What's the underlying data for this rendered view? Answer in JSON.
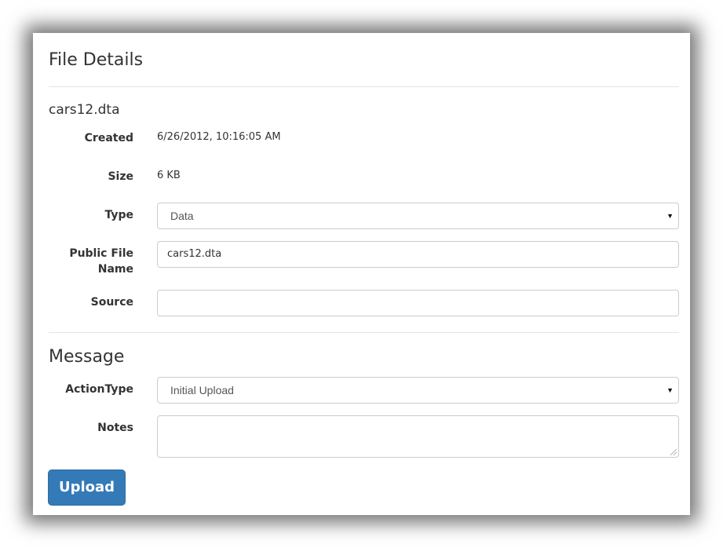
{
  "file_details": {
    "heading": "File Details",
    "filename": "cars12.dta",
    "created_label": "Created",
    "created_value": "6/26/2012, 10:16:05 AM",
    "size_label": "Size",
    "size_value": "6 KB",
    "type_label": "Type",
    "type_value": "Data",
    "public_name_label_line1": "Public File",
    "public_name_label_line2": "Name",
    "public_name_value": "cars12.dta",
    "source_label": "Source",
    "source_value": ""
  },
  "message": {
    "heading": "Message",
    "action_type_label": "ActionType",
    "action_type_value": "Initial Upload",
    "notes_label": "Notes",
    "notes_value": ""
  },
  "actions": {
    "upload_label": "Upload"
  },
  "colors": {
    "primary_button": "#337ab7",
    "border": "#cccccc"
  },
  "icons": {
    "select_arrow": "caret-down-icon"
  }
}
